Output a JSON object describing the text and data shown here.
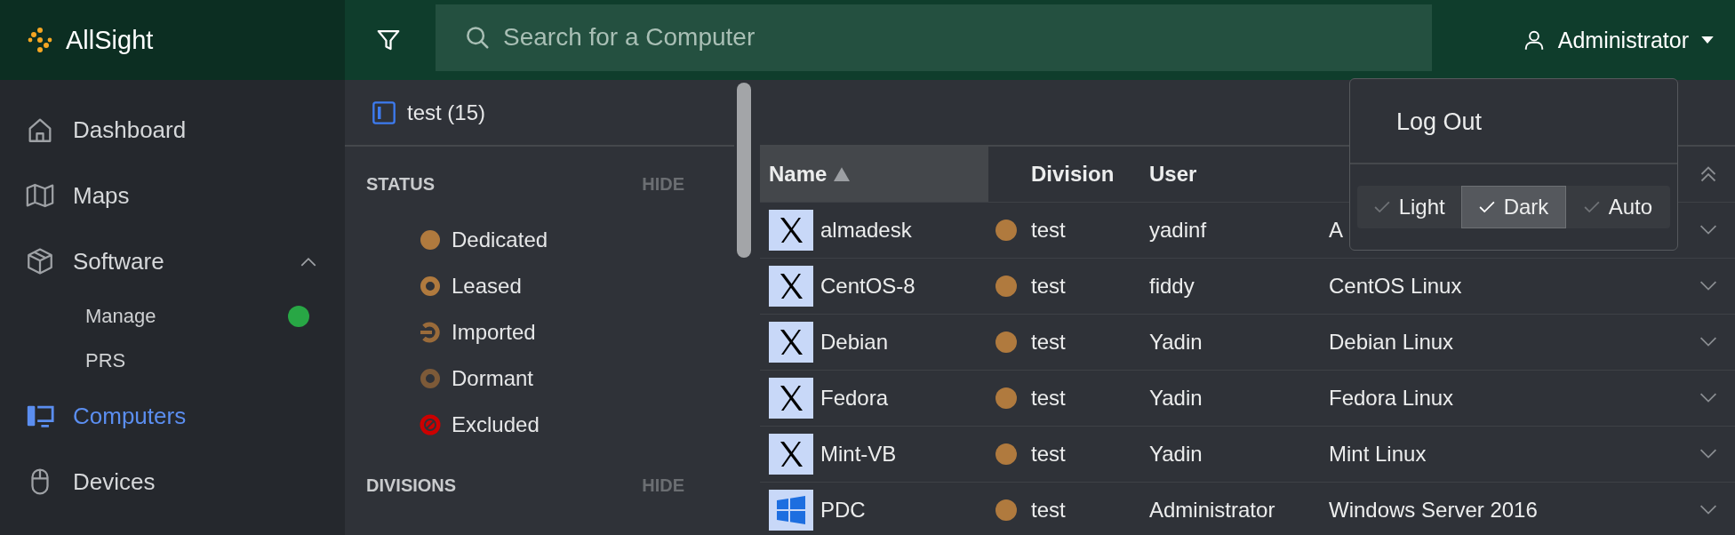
{
  "brand": {
    "name": "AllSight"
  },
  "search": {
    "placeholder": "Search for a Computer"
  },
  "user": {
    "name": "Administrator"
  },
  "sidebar": {
    "items": [
      {
        "label": "Dashboard",
        "selected": false
      },
      {
        "label": "Maps",
        "selected": false
      },
      {
        "label": "Software",
        "selected": false,
        "expanded": true,
        "children": [
          {
            "label": "Manage",
            "color": "#28a745"
          },
          {
            "label": "PRS"
          }
        ]
      },
      {
        "label": "Computers",
        "selected": true
      },
      {
        "label": "Devices",
        "selected": false
      }
    ]
  },
  "filters": {
    "title": "test (15)",
    "sections": [
      {
        "title": "STATUS",
        "action": "HIDE",
        "items": [
          {
            "label": "Dedicated",
            "kind": "filled",
            "color": "#b07a3e"
          },
          {
            "label": "Leased",
            "kind": "ring",
            "color": "#b07a3e"
          },
          {
            "label": "Imported",
            "kind": "plug",
            "color": "#9a6b3a"
          },
          {
            "label": "Dormant",
            "kind": "ring",
            "color": "#7d5a38"
          },
          {
            "label": "Excluded",
            "kind": "blocked",
            "color": "#cc0000"
          }
        ]
      },
      {
        "title": "DIVISIONS",
        "action": "HIDE"
      }
    ]
  },
  "table": {
    "columns": [
      {
        "label": "Name",
        "sorted": true
      },
      {
        "label": "Division",
        "sorted": false
      },
      {
        "label": "User",
        "sorted": false
      }
    ],
    "rows": [
      {
        "name": "almadesk",
        "kind": "x11",
        "color": "#b07a3e",
        "division": "test",
        "user": "yadinf",
        "os": "A"
      },
      {
        "name": "CentOS-8",
        "kind": "x11",
        "color": "#b07a3e",
        "division": "test",
        "user": "fiddy",
        "os": "CentOS Linux"
      },
      {
        "name": "Debian",
        "kind": "x11",
        "color": "#b07a3e",
        "division": "test",
        "user": "Yadin",
        "os": "Debian Linux"
      },
      {
        "name": "Fedora",
        "kind": "x11",
        "color": "#b07a3e",
        "division": "test",
        "user": "Yadin",
        "os": "Fedora Linux"
      },
      {
        "name": "Mint-VB",
        "kind": "x11",
        "color": "#b07a3e",
        "division": "test",
        "user": "Yadin",
        "os": "Mint Linux"
      },
      {
        "name": "PDC",
        "kind": "windows",
        "color": "#b07a3e",
        "division": "test",
        "user": "Administrator",
        "os": "Windows Server 2016"
      }
    ]
  },
  "user_menu": {
    "items": [
      "Log Out"
    ],
    "theme": [
      {
        "label": "Light",
        "selected": false
      },
      {
        "label": "Dark",
        "selected": true
      },
      {
        "label": "Auto",
        "selected": false
      }
    ]
  }
}
